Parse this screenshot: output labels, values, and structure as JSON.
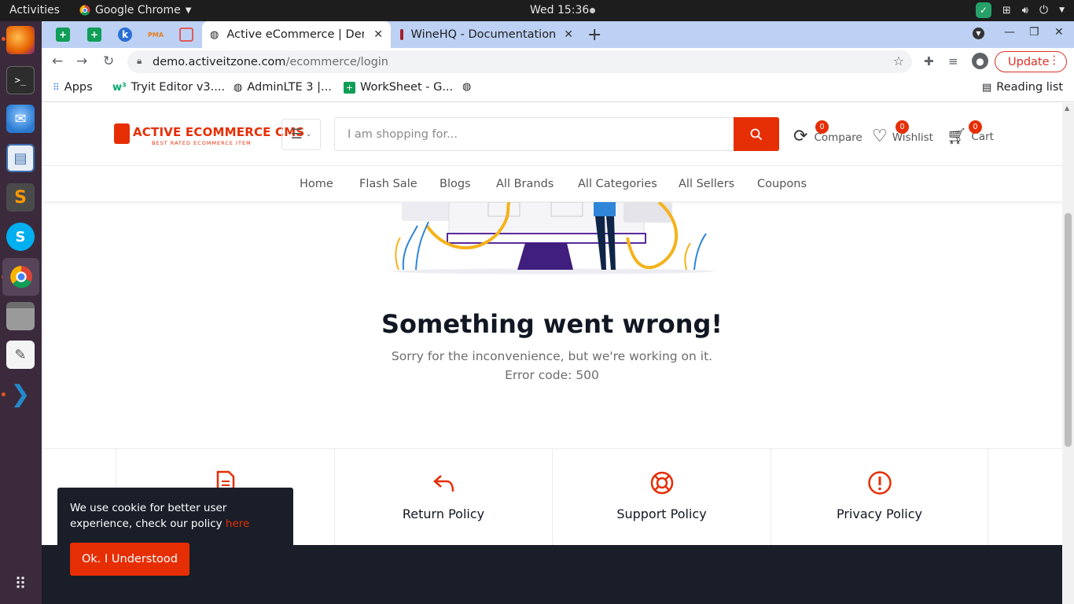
{
  "desktop": {
    "activities": "Activities",
    "app_name": "Google Chrome",
    "clock": "Wed 15:36"
  },
  "dock": [
    {
      "name": "firefox",
      "color": "#e66000"
    },
    {
      "name": "terminal",
      "color": "#2d2d2d"
    },
    {
      "name": "thunderbird",
      "color": "#2a7ad1"
    },
    {
      "name": "document-viewer",
      "color": "#3d6fb0"
    },
    {
      "name": "sublime-text",
      "color": "#ff9800"
    },
    {
      "name": "skype",
      "color": "#00aff0"
    },
    {
      "name": "chrome",
      "color": "#4285f4"
    },
    {
      "name": "files",
      "color": "#8d8d8d"
    },
    {
      "name": "text-editor",
      "color": "#f4f4f4"
    },
    {
      "name": "vscode",
      "color": "#2489ca"
    }
  ],
  "browser": {
    "tabs": [
      {
        "label": "Active eCommerce | Demo"
      },
      {
        "label": "WineHQ - Documentation"
      }
    ],
    "url_host": "demo.activeitzone.com",
    "url_path": "/ecommerce/login",
    "update_label": "Update",
    "bookmarks": [
      "Apps",
      "Tryit Editor v3....",
      "AdminLTE 3 |...",
      "WorkSheet - G..."
    ],
    "reading_list": "Reading list"
  },
  "site": {
    "logo_text": "ACTIVE ECOMMERCE CMS",
    "logo_tagline": "BEST RATED ECOMMERCE ITEM",
    "search_placeholder": "I am shopping for...",
    "compare": {
      "label": "Compare",
      "count": "0"
    },
    "wishlist": {
      "label": "Wishlist",
      "count": "0"
    },
    "cart": {
      "label": "Cart",
      "count": "0"
    },
    "menu": [
      "Home",
      "Flash Sale",
      "Blogs",
      "All Brands",
      "All Categories",
      "All Sellers",
      "Coupons"
    ],
    "error_title": "Something went wrong!",
    "error_subtitle": "Sorry for the inconvenience, but we're working on it.",
    "error_code": "Error code: 500",
    "policies": [
      "Return Policy",
      "Support Policy",
      "Privacy Policy"
    ],
    "accent": "#e62e04"
  },
  "cookie": {
    "text": "We use cookie for better user experience, check our policy ",
    "link": "here",
    "button": "Ok. I Understood"
  }
}
